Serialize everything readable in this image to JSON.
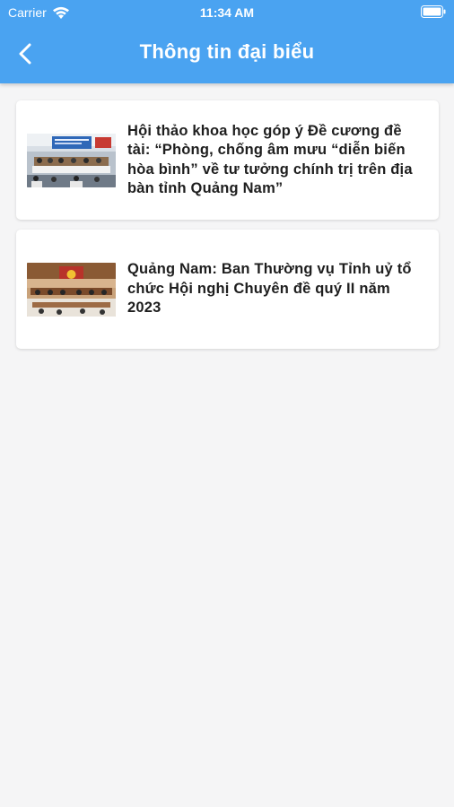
{
  "status_bar": {
    "carrier": "Carrier",
    "time": "11:34 AM",
    "wifi_icon": "wifi-icon",
    "battery_icon": "battery-icon"
  },
  "header": {
    "title": "Thông tin đại biểu",
    "back_icon": "chevron-left-icon",
    "background_color": "#4aa3f1"
  },
  "articles": [
    {
      "title": "Hội thảo khoa học góp ý Đề cương đề tài: “Phòng, chống âm mưu “diễn biến hòa bình” về tư tưởng chính trị trên địa bàn tỉnh Quảng Nam”",
      "thumbnail": "conference-room-photo"
    },
    {
      "title": "Quảng Nam: Ban Thường vụ Tỉnh uỷ tổ chức Hội nghị Chuyên đề quý II năm 2023",
      "thumbnail": "meeting-hall-photo"
    }
  ]
}
